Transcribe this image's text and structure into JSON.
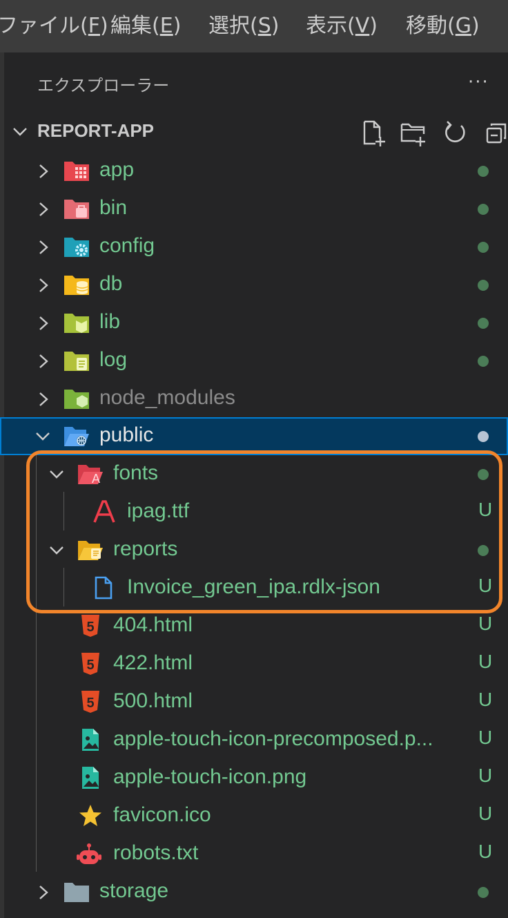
{
  "menubar": {
    "items": [
      {
        "label": "ファイル(",
        "key": "F",
        "suffix": ")"
      },
      {
        "label": "編集(",
        "key": "E",
        "suffix": ")"
      },
      {
        "label": "選択(",
        "key": "S",
        "suffix": ")"
      },
      {
        "label": "表示(",
        "key": "V",
        "suffix": ")"
      },
      {
        "label": "移動(",
        "key": "G",
        "suffix": ")"
      }
    ]
  },
  "explorer": {
    "title": "エクスプローラー",
    "more_label": "···",
    "section_title": "REPORT-APP"
  },
  "tree": {
    "app": {
      "label": "app"
    },
    "bin": {
      "label": "bin"
    },
    "config": {
      "label": "config"
    },
    "db": {
      "label": "db"
    },
    "lib": {
      "label": "lib"
    },
    "log": {
      "label": "log"
    },
    "node_modules": {
      "label": "node_modules"
    },
    "public": {
      "label": "public"
    },
    "fonts": {
      "label": "fonts"
    },
    "ipag": {
      "label": "ipag.ttf",
      "status": "U"
    },
    "reports": {
      "label": "reports"
    },
    "invoice": {
      "label": "Invoice_green_ipa.rdlx-json",
      "status": "U"
    },
    "f404": {
      "label": "404.html",
      "status": "U"
    },
    "f422": {
      "label": "422.html",
      "status": "U"
    },
    "f500": {
      "label": "500.html",
      "status": "U"
    },
    "apple_pre": {
      "label": "apple-touch-icon-precomposed.p...",
      "status": "U"
    },
    "apple": {
      "label": "apple-touch-icon.png",
      "status": "U"
    },
    "favicon": {
      "label": "favicon.ico",
      "status": "U"
    },
    "robots": {
      "label": "robots.txt",
      "status": "U"
    },
    "storage": {
      "label": "storage"
    }
  },
  "colors": {
    "untracked": "#73c991",
    "ignored": "#8c8c8c",
    "highlight": "#f2852b",
    "selection": "#04395e"
  }
}
